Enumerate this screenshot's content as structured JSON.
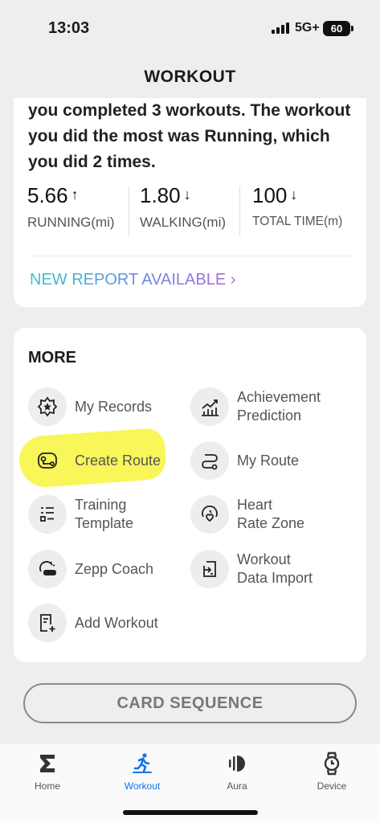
{
  "status_bar": {
    "time": "13:03",
    "network": "5G+",
    "battery": "60"
  },
  "header": {
    "title": "WORKOUT"
  },
  "report": {
    "summary": "you completed 3 workouts. The workout you did the most was Running, which you did 2 times.",
    "stats": [
      {
        "value": "5.66",
        "arrow": "↑",
        "label": "RUNNING(mi)"
      },
      {
        "value": "1.80",
        "arrow": "↓",
        "label": "WALKING(mi)"
      },
      {
        "value": "100",
        "arrow": "↓",
        "label": "TOTAL TIME(m)"
      }
    ],
    "new_report_link": "NEW REPORT AVAILABLE  ›"
  },
  "more": {
    "title": "MORE",
    "items": [
      {
        "label": "My Records",
        "icon": "badge-star-icon"
      },
      {
        "label": "Achievement\nPrediction",
        "icon": "bar-chart-trend-icon"
      },
      {
        "label": "Create Route",
        "icon": "route-create-icon"
      },
      {
        "label": "My Route",
        "icon": "route-icon"
      },
      {
        "label": "Training\nTemplate",
        "icon": "list-template-icon"
      },
      {
        "label": "Heart\nRate Zone",
        "icon": "heart-rate-icon"
      },
      {
        "label": "Zepp Coach",
        "icon": "zepp-coach-icon"
      },
      {
        "label": "Workout\nData Import",
        "icon": "import-icon"
      },
      {
        "label": "Add Workout",
        "icon": "add-document-icon"
      }
    ]
  },
  "card_sequence_label": "CARD SEQUENCE",
  "tabs": [
    {
      "label": "Home",
      "icon": "sigma-icon",
      "active": false
    },
    {
      "label": "Workout",
      "icon": "runner-icon",
      "active": true
    },
    {
      "label": "Aura",
      "icon": "sound-wave-icon",
      "active": false
    },
    {
      "label": "Device",
      "icon": "watch-icon",
      "active": false
    }
  ],
  "colors": {
    "active_tab": "#1673e8",
    "highlight": "#f8f53c",
    "background": "#eeeef0"
  }
}
